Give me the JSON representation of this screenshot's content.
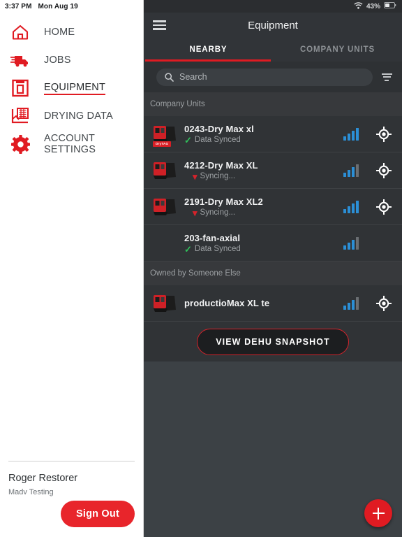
{
  "status_bar": {
    "time": "3:37 PM",
    "date": "Mon Aug 19",
    "battery_percent": "43%",
    "wifi_icon": "wifi-icon",
    "battery_icon": "battery-icon"
  },
  "sidebar": {
    "items": [
      {
        "label": "HOME",
        "icon": "home-icon",
        "active": false
      },
      {
        "label": "JOBS",
        "icon": "truck-icon",
        "active": false
      },
      {
        "label": "EQUIPMENT",
        "icon": "equipment-box-icon",
        "active": true
      },
      {
        "label": "DRYING DATA",
        "icon": "drying-data-chart-icon",
        "active": false
      },
      {
        "label": "ACCOUNT SETTINGS",
        "icon": "gear-icon",
        "active": false
      }
    ],
    "footer": {
      "user_name": "Roger Restorer",
      "organization": "Madv Testing",
      "sign_out_label": "Sign Out"
    }
  },
  "main": {
    "appbar": {
      "menu_icon": "hamburger-menu-icon",
      "title": "Equipment"
    },
    "tabs": [
      {
        "label": "NEARBY",
        "active": true
      },
      {
        "label": "COMPANY UNITS",
        "active": false
      }
    ],
    "search": {
      "icon": "search-icon",
      "value": "",
      "placeholder": "Search",
      "filter_icon": "filter-icon"
    },
    "sections": [
      {
        "title": "Company Units",
        "rows": [
          {
            "title": "0243-Dry Max xl",
            "status": "Data Synced",
            "status_type": "synced",
            "status_icon": "check-icon",
            "has_thumbnail": true,
            "thumbnail_badge": "DryTAG",
            "signal_bars": 4,
            "signal_total": 4,
            "has_locate": true,
            "locate_icon": "locate-target-icon"
          },
          {
            "title": "4212-Dry Max XL",
            "status": "Syncing...",
            "status_type": "syncing",
            "status_icon": "chevron-down-icon",
            "has_thumbnail": true,
            "thumbnail_badge": "",
            "signal_bars": 3,
            "signal_total": 4,
            "has_locate": true,
            "locate_icon": "locate-target-icon"
          },
          {
            "title": "2191-Dry Max XL2",
            "status": "Syncing...",
            "status_type": "syncing",
            "status_icon": "chevron-down-icon",
            "has_thumbnail": true,
            "thumbnail_badge": "",
            "signal_bars": 4,
            "signal_total": 4,
            "has_locate": true,
            "locate_icon": "locate-target-icon"
          },
          {
            "title": "203-fan-axial",
            "status": "Data Synced",
            "status_type": "synced",
            "status_icon": "check-icon",
            "has_thumbnail": false,
            "thumbnail_badge": "",
            "signal_bars": 3,
            "signal_total": 4,
            "has_locate": false,
            "locate_icon": "locate-target-icon"
          }
        ]
      },
      {
        "title": "Owned by Someone Else",
        "rows": [
          {
            "title": "productioMax XL te",
            "status": "",
            "status_type": "none",
            "status_icon": "",
            "has_thumbnail": true,
            "thumbnail_badge": "",
            "signal_bars": 3,
            "signal_total": 4,
            "has_locate": true,
            "locate_icon": "locate-target-icon"
          }
        ]
      }
    ],
    "snapshot_button": "VIEW DEHU SNAPSHOT",
    "fab": {
      "icon": "plus-icon",
      "label": "+"
    }
  },
  "colors": {
    "brand_red": "#e01b22",
    "signal_blue": "#2b8fd6",
    "synced_green": "#2fc05a",
    "syncing_red": "#d4232b",
    "panel_dark": "#303336",
    "appbar_dark": "#313438",
    "background_slate": "#3c4145"
  }
}
